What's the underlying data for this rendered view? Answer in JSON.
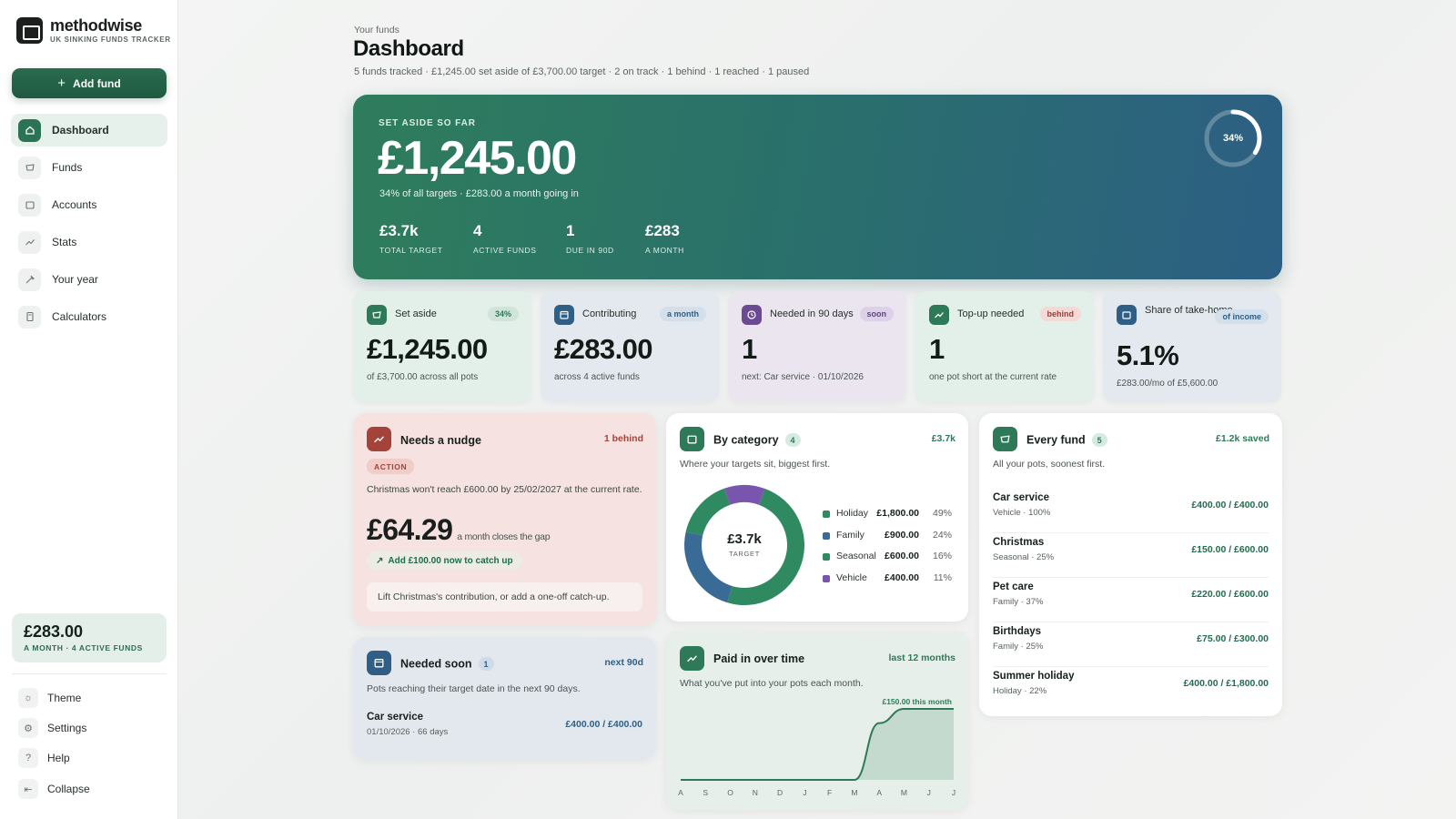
{
  "brand": {
    "name": "methodwise",
    "tagline": "UK SINKING FUNDS TRACKER"
  },
  "sidebar": {
    "add_button": "Add fund",
    "nav": [
      {
        "label": "Dashboard",
        "icon": "home-icon",
        "active": true
      },
      {
        "label": "Funds",
        "icon": "piggy-bank-icon"
      },
      {
        "label": "Accounts",
        "icon": "wallet-icon"
      },
      {
        "label": "Stats",
        "icon": "trend-icon"
      },
      {
        "label": "Your year",
        "icon": "sparkle-icon"
      },
      {
        "label": "Calculators",
        "icon": "calculator-icon"
      }
    ],
    "summary": {
      "amount": "£283.00",
      "label": "A MONTH · 4 ACTIVE FUNDS"
    },
    "footer": [
      {
        "label": "Theme",
        "icon": "sun-icon"
      },
      {
        "label": "Settings",
        "icon": "gear-icon"
      },
      {
        "label": "Help",
        "icon": "help-icon"
      },
      {
        "label": "Collapse",
        "icon": "collapse-icon"
      }
    ]
  },
  "header": {
    "kicker": "Your funds",
    "title": "Dashboard",
    "subtitle": "5 funds tracked · £1,245.00 set aside of £3,700.00 target · 2 on track · 1 behind · 1 reached · 1 paused"
  },
  "hero": {
    "kicker": "SET ASIDE SO FAR",
    "amount": "£1,245.00",
    "subtitle": "34% of all targets · £283.00 a month going in",
    "progress_percent": 34,
    "progress_label": "34%",
    "stats": [
      {
        "value": "£3.7k",
        "label": "TOTAL TARGET"
      },
      {
        "value": "4",
        "label": "ACTIVE FUNDS"
      },
      {
        "value": "1",
        "label": "DUE IN 90D"
      },
      {
        "value": "£283",
        "label": "A MONTH"
      }
    ]
  },
  "stats": [
    {
      "label": "Set aside",
      "badge": "34%",
      "value": "£1,245.00",
      "foot": "of £3,700.00 across all pots",
      "icon": "piggy-bank-icon",
      "bg": "#e3efe9",
      "accent": "#2e7a58",
      "badge_bg": "#cfe5da",
      "badge_fg": "#2e7a58"
    },
    {
      "label": "Contributing",
      "badge": "a month",
      "value": "£283.00",
      "foot": "across 4 active funds",
      "icon": "calendar-icon",
      "bg": "#e4e9ef",
      "accent": "#2f5f86",
      "badge_bg": "#d3dfeb",
      "badge_fg": "#2f5f86"
    },
    {
      "label": "Needed in 90 days",
      "badge": "soon",
      "value": "1",
      "foot": "next: Car service · 01/10/2026",
      "icon": "clock-icon",
      "bg": "#ebe5f0",
      "accent": "#6a4a92",
      "badge_bg": "#ddd1ea",
      "badge_fg": "#5f4486"
    },
    {
      "label": "Top-up needed",
      "badge": "behind",
      "value": "1",
      "foot": "one pot short at the current rate",
      "icon": "trend-icon",
      "bg": "#e3efe9",
      "accent": "#2e7a58",
      "badge_bg": "#f4d9d6",
      "badge_fg": "#a23d33"
    },
    {
      "label": "Share of take-home",
      "badge": "of income",
      "value": "5.1%",
      "foot": "£283.00/mo of £5,600.00",
      "icon": "wallet-icon",
      "bg": "#e4e9ef",
      "accent": "#2f5f86",
      "badge_bg": "#d3dfeb",
      "badge_fg": "#2f5f86"
    }
  ],
  "nudge": {
    "title": "Needs a nudge",
    "right": "1 behind",
    "tag": "ACTION",
    "desc": "Christmas won't reach £600.00 by 25/02/2027 at the current rate.",
    "amount": "£64.29",
    "amount_note": "a month closes the gap",
    "catchup": "Add £100.00 now to catch up",
    "tip": "Lift Christmas's contribution, or add a one-off catch-up."
  },
  "category": {
    "title": "By category",
    "count": "4",
    "right": "£3.7k",
    "desc": "Where your targets sit, biggest first.",
    "center_value": "£3.7k",
    "center_label": "TARGET",
    "items": [
      {
        "name": "Holiday",
        "amount": "£1,800.00",
        "pct": "49%",
        "value": 49,
        "color": "#2f8a62"
      },
      {
        "name": "Family",
        "amount": "£900.00",
        "pct": "24%",
        "value": 24,
        "color": "#3a6b96"
      },
      {
        "name": "Seasonal",
        "amount": "£600.00",
        "pct": "16%",
        "value": 16,
        "color": "#2f8a62"
      },
      {
        "name": "Vehicle",
        "amount": "£400.00",
        "pct": "11%",
        "value": 11,
        "color": "#7a55ad"
      }
    ]
  },
  "funds": {
    "title": "Every fund",
    "count": "5",
    "right": "£1.2k saved",
    "desc": "All your pots, soonest first.",
    "items": [
      {
        "name": "Car service",
        "meta": "Vehicle · 100%",
        "amount": "£400.00 / £400.00"
      },
      {
        "name": "Christmas",
        "meta": "Seasonal · 25%",
        "amount": "£150.00 / £600.00"
      },
      {
        "name": "Pet care",
        "meta": "Family · 37%",
        "amount": "£220.00 / £600.00"
      },
      {
        "name": "Birthdays",
        "meta": "Family · 25%",
        "amount": "£75.00 / £300.00"
      },
      {
        "name": "Summer holiday",
        "meta": "Holiday · 22%",
        "amount": "£400.00 / £1,800.00"
      }
    ]
  },
  "soon": {
    "title": "Needed soon",
    "count": "1",
    "right": "next 90d",
    "desc": "Pots reaching their target date in the next 90 days.",
    "item": {
      "name": "Car service",
      "meta": "01/10/2026 · 66 days",
      "amount": "£400.00 / £400.00"
    }
  },
  "paid": {
    "title": "Paid in over time",
    "right": "last 12 months",
    "desc": "What you've put into your pots each month."
  },
  "chart_data": {
    "type": "area",
    "title": "Paid in over time",
    "x": [
      "A",
      "S",
      "O",
      "N",
      "D",
      "J",
      "F",
      "M",
      "A",
      "M",
      "J",
      "J"
    ],
    "y": [
      0,
      0,
      0,
      0,
      0,
      0,
      0,
      0,
      120,
      150,
      150,
      150
    ],
    "annotation": "£150.00 this month",
    "ylim": [
      0,
      150
    ],
    "grid": false,
    "color": "#2e7a58"
  }
}
